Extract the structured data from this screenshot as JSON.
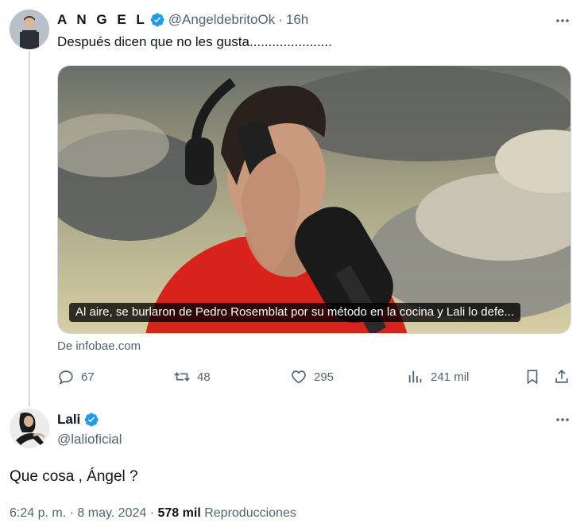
{
  "tweet": {
    "author_name": "A N G E L",
    "handle": "@AngeldebritoOk",
    "time": "16h",
    "text": "Después dicen que no les gusta......................",
    "media_caption": "Al aire, se burlaron de Pedro Rosemblat por su método en la cocina y Lali lo defe...",
    "source": "De infobae.com",
    "stats": {
      "replies": "67",
      "retweets": "48",
      "likes": "295",
      "views": "241 mil"
    }
  },
  "reply": {
    "author_name": "Lali",
    "handle": "@lalioficial",
    "text": "Que cosa , Ángel ?",
    "time": "6:24 p. m.",
    "date": "8 may. 2024",
    "views_count": "578 mil",
    "views_label": "Reproducciones"
  },
  "icons": [
    "verified-badge-icon",
    "more-icon",
    "reply-icon",
    "retweet-icon",
    "like-icon",
    "views-icon",
    "bookmark-icon",
    "share-icon"
  ],
  "colors": {
    "verified": "#1d9bf0",
    "muted_text": "#536471",
    "primary_text": "#0f1419",
    "thread_line": "#cfd9de"
  }
}
